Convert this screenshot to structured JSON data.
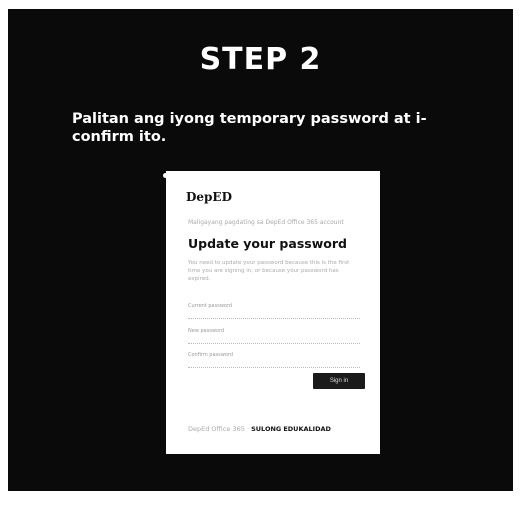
{
  "slide": {
    "title": "STEP 2",
    "instruction": "Palitan ang iyong temporary password at i-confirm ito."
  },
  "card": {
    "logo": "DepED",
    "hint": "Maligayang pagdating sa DepEd Office 365 account",
    "heading": "Update your password",
    "description": "You need to update your password because this is the first time you are signing in, or because your password has expired.",
    "fields": [
      {
        "label": "Current password",
        "value": ""
      },
      {
        "label": "New password",
        "value": ""
      },
      {
        "label": "Confirm password",
        "value": ""
      }
    ],
    "button": "Sign in",
    "footer": {
      "prefix": "DepEd Office 365 ·",
      "brand1": "SULONG",
      "middle": "",
      "brand2": "EDUKALIDAD"
    }
  },
  "colors": {
    "panel_bg": "#0a0a0a",
    "text": "#ffffff",
    "button_bg": "#1a1a1a"
  }
}
